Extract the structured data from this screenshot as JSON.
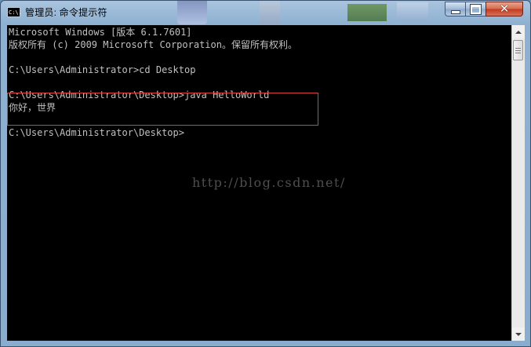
{
  "window": {
    "title": "管理员: 命令提示符",
    "app_icon_text": "C:\\."
  },
  "console": {
    "lines": [
      "Microsoft Windows [版本 6.1.7601]",
      "版权所有 (c) 2009 Microsoft Corporation。保留所有权利。",
      "",
      "C:\\Users\\Administrator>cd Desktop",
      "",
      "C:\\Users\\Administrator\\Desktop>java HelloWorld",
      "你好，世界",
      "",
      "C:\\Users\\Administrator\\Desktop>"
    ],
    "watermark": "http://blog.csdn.net/"
  },
  "colors": {
    "console_bg": "#000000",
    "console_text": "#c0c0c0",
    "highlight_box": "#d8423e",
    "close_button": "#c13a1c"
  },
  "icons": {
    "app": "cmd-icon",
    "minimize": "minimize-icon",
    "maximize": "maximize-icon",
    "close": "close-icon",
    "scroll_up": "scroll-up-arrow-icon",
    "scroll_down": "scroll-down-arrow-icon"
  }
}
